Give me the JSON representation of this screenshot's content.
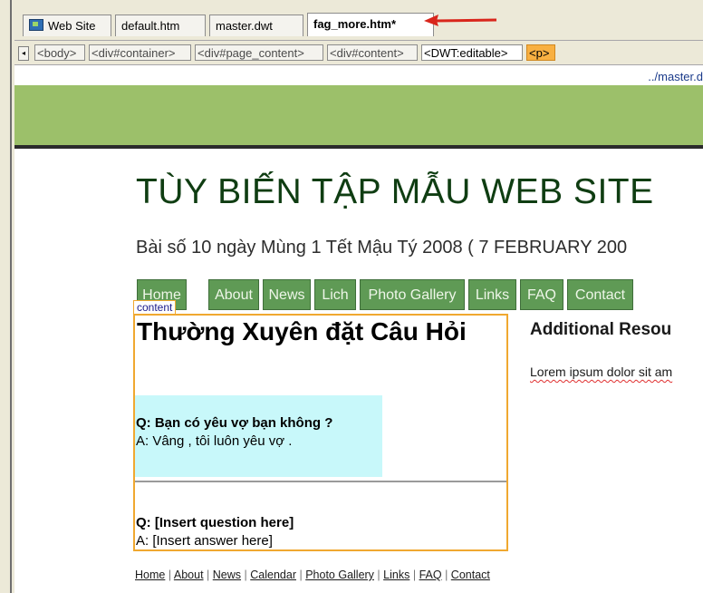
{
  "tabs": [
    {
      "label": "Web Site",
      "icon": "site-icon"
    },
    {
      "label": "default.htm"
    },
    {
      "label": "master.dwt"
    },
    {
      "label": "fag_more.htm*"
    }
  ],
  "tag_bar": [
    "<body>",
    "<div#container>",
    "<div#page_content>",
    "<div#content>",
    "<DWT:editable>",
    "<p>"
  ],
  "master_path": "../master.d",
  "page": {
    "site_title": "TÙY BIẾN TẬP MẪU WEB SITE",
    "subtitle": "Bài số 10 ngày Mùng 1 Tết Mậu Tý 2008 ( 7 FEBRUARY 200",
    "nav": [
      "Home",
      "About",
      "News",
      "Lich",
      "Photo Gallery",
      "Links",
      "FAQ",
      "Contact"
    ],
    "content_label": "content",
    "faq_heading": "Thường Xuyên đặt Câu Hỏi",
    "q1": "Q: Bạn có yêu vợ bạn không ?",
    "a1": "A: Vâng , tôi luôn yêu vợ .",
    "q2": "Q: [Insert question here]",
    "a2": "A: [Insert answer here]",
    "side_heading": "Additional Resou",
    "side_text": "Lorem ipsum dolor sit am",
    "footer": [
      "Home",
      "About",
      "News",
      "Calendar",
      "Photo Gallery",
      "Links",
      "FAQ",
      "Contact"
    ],
    "footer_sep": "|"
  },
  "colors": {
    "banner": "#9cc06a",
    "nav_button": "#5f9a55",
    "site_title": "#0f3d12",
    "editable_outline": "#f0a830",
    "highlight_box": "#c8f8fa",
    "selected_tag": "#f8b042",
    "annotation_arrow": "#d9261c"
  }
}
